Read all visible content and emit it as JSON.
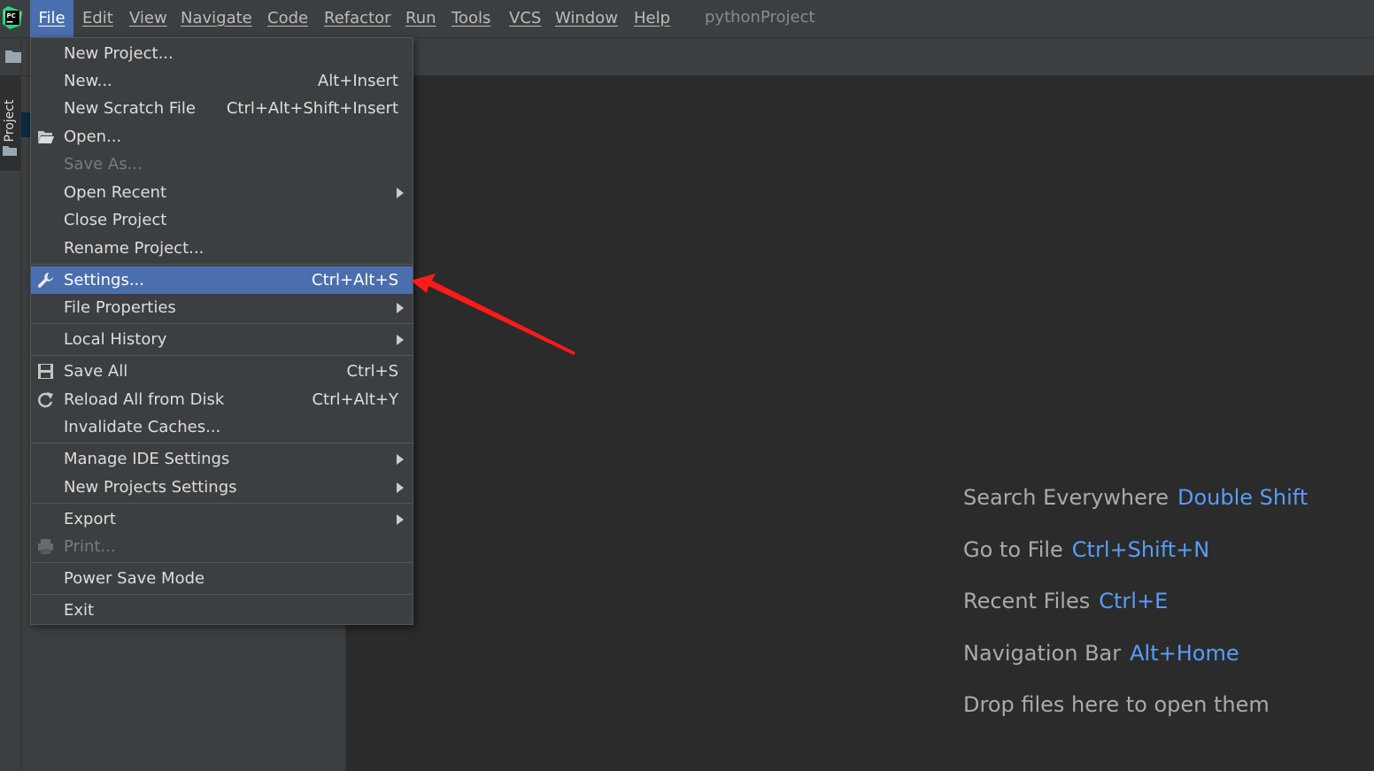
{
  "menubar": {
    "items": [
      {
        "label": "File"
      },
      {
        "label": "Edit"
      },
      {
        "label": "View"
      },
      {
        "label": "Navigate"
      },
      {
        "label": "Code"
      },
      {
        "label": "Refactor"
      },
      {
        "label": "Run"
      },
      {
        "label": "Tools"
      },
      {
        "label": "VCS"
      },
      {
        "label": "Window"
      },
      {
        "label": "Help"
      }
    ],
    "project_name": "pythonProject",
    "logo_text": "PC"
  },
  "tool_window": {
    "project_tab_label": "Project"
  },
  "file_menu": {
    "items": [
      {
        "label": "New Project...",
        "shortcut": ""
      },
      {
        "label": "New...",
        "shortcut": "Alt+Insert"
      },
      {
        "label": "New Scratch File",
        "shortcut": "Ctrl+Alt+Shift+Insert"
      },
      {
        "label": "Open...",
        "shortcut": "",
        "icon": "folder-open-icon"
      },
      {
        "label": "Save As...",
        "shortcut": "",
        "disabled": true
      },
      {
        "label": "Open Recent",
        "shortcut": "",
        "submenu": true
      },
      {
        "label": "Close Project",
        "shortcut": ""
      },
      {
        "label": "Rename Project...",
        "shortcut": ""
      },
      {
        "label": "Settings...",
        "shortcut": "Ctrl+Alt+S",
        "icon": "wrench-icon",
        "selected": true
      },
      {
        "label": "File Properties",
        "shortcut": "",
        "submenu": true
      },
      {
        "label": "Local History",
        "shortcut": "",
        "submenu": true
      },
      {
        "label": "Save All",
        "shortcut": "Ctrl+S",
        "icon": "save-icon"
      },
      {
        "label": "Reload All from Disk",
        "shortcut": "Ctrl+Alt+Y",
        "icon": "reload-icon"
      },
      {
        "label": "Invalidate Caches...",
        "shortcut": ""
      },
      {
        "label": "Manage IDE Settings",
        "shortcut": "",
        "submenu": true
      },
      {
        "label": "New Projects Settings",
        "shortcut": "",
        "submenu": true
      },
      {
        "label": "Export",
        "shortcut": "",
        "submenu": true
      },
      {
        "label": "Print...",
        "shortcut": "",
        "icon": "printer-icon",
        "disabled": true
      },
      {
        "label": "Power Save Mode",
        "shortcut": ""
      },
      {
        "label": "Exit",
        "shortcut": ""
      }
    ]
  },
  "editor_hints": [
    {
      "text": "Search Everywhere",
      "key": "Double Shift"
    },
    {
      "text": "Go to File",
      "key": "Ctrl+Shift+N"
    },
    {
      "text": "Recent Files",
      "key": "Ctrl+E"
    },
    {
      "text": "Navigation Bar",
      "key": "Alt+Home"
    },
    {
      "text": "Drop files here to open them",
      "key": ""
    }
  ],
  "colors": {
    "menu_background": "#3c3f41",
    "editor_background": "#2b2b2b",
    "selection": "#4b6eaf",
    "shortcut_key": "#589df6",
    "annotation_arrow": "#ff1a1a"
  }
}
